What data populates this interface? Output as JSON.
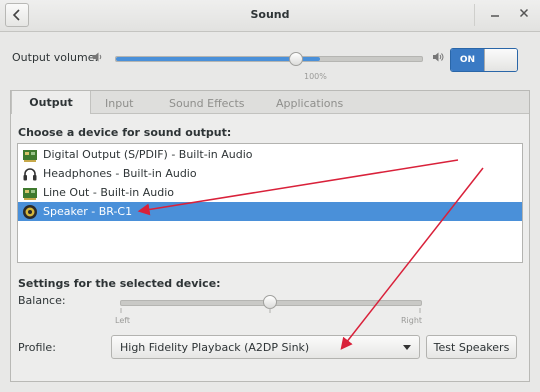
{
  "window": {
    "title": "Sound"
  },
  "output_volume": {
    "label": "Output volume:",
    "level_percent": 100,
    "tick_label": "100%",
    "switch_label": "ON"
  },
  "tabs": [
    {
      "label": "Output",
      "active": true
    },
    {
      "label": "Input",
      "active": false
    },
    {
      "label": "Sound Effects",
      "active": false
    },
    {
      "label": "Applications",
      "active": false
    }
  ],
  "output_section": {
    "heading": "Choose a device for sound output:",
    "devices": [
      {
        "label": "Digital Output (S/PDIF) - Built-in Audio",
        "icon": "audio-card-icon",
        "selected": false
      },
      {
        "label": "Headphones - Built-in Audio",
        "icon": "headphones-icon",
        "selected": false
      },
      {
        "label": "Line Out - Built-in Audio",
        "icon": "audio-card-icon",
        "selected": false
      },
      {
        "label": "Speaker - BR-C1",
        "icon": "bluetooth-speaker-icon",
        "selected": true
      }
    ]
  },
  "settings": {
    "heading": "Settings for the selected device:",
    "balance_label": "Balance:",
    "balance_left": "Left",
    "balance_right": "Right",
    "balance_value": 0,
    "profile_label": "Profile:",
    "profile_value": "High Fidelity Playback (A2DP Sink)",
    "test_button": "Test Speakers"
  },
  "colors": {
    "accent": "#4a90d9",
    "annotation_arrow": "#d9213a"
  }
}
